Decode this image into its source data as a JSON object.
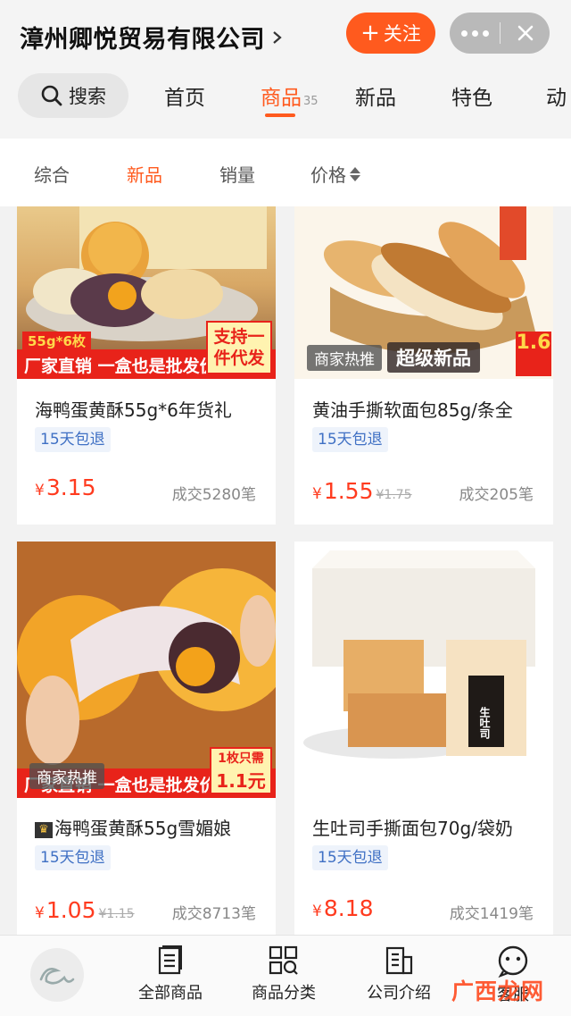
{
  "header": {
    "shop_name": "漳州卿悦贸易有限公司",
    "follow_label": "关注"
  },
  "nav": {
    "search_label": "搜索",
    "tabs": [
      {
        "label": "首页",
        "count": ""
      },
      {
        "label": "商品",
        "count": "35"
      },
      {
        "label": "新品",
        "count": ""
      },
      {
        "label": "特色",
        "count": ""
      },
      {
        "label": "动",
        "count": ""
      }
    ],
    "active_tab": "商品"
  },
  "filters": {
    "items": [
      "综合",
      "新品",
      "销量",
      "价格"
    ],
    "active": "新品"
  },
  "products": [
    {
      "title": "海鸭蛋黄酥55g*6年货礼",
      "badge": "15天包退",
      "currency": "¥",
      "price": "3.15",
      "old_price": "",
      "sold": "成交5280笔",
      "image_text": {
        "spec": "55g*6枚",
        "strip": "厂家直销 一盒也是批发价",
        "support": "支持一件代发"
      }
    },
    {
      "title": "黄油手撕软面包85g/条全",
      "badge": "15天包退",
      "currency": "¥",
      "price": "1.55",
      "old_price": "¥1.75",
      "sold": "成交205笔",
      "hot_tag": "商家热推",
      "new_tag": "超级新品",
      "image_text": {
        "price_tag": "1.6"
      }
    },
    {
      "title": "海鸭蛋黄酥55g雪媚娘",
      "badge": "15天包退",
      "currency": "¥",
      "price": "1.05",
      "old_price": "¥1.15",
      "sold": "成交8713笔",
      "hot_tag": "商家热推",
      "image_text": {
        "strip": "厂家直销 一盒也是批发价",
        "unit": "1枚只需",
        "unit_price": "1.1元"
      }
    },
    {
      "title": "生吐司手撕面包70g/袋奶",
      "badge": "15天包退",
      "currency": "¥",
      "price": "8.18",
      "old_price": "",
      "sold": "成交1419笔",
      "image_text": {
        "bag_label": "生吐司"
      }
    }
  ],
  "bottom_nav": {
    "items": [
      {
        "label": "全部商品",
        "icon": "list-icon"
      },
      {
        "label": "商品分类",
        "icon": "category-icon"
      },
      {
        "label": "公司介绍",
        "icon": "company-icon"
      },
      {
        "label": "客服",
        "icon": "chat-icon"
      }
    ]
  },
  "watermark": "广西龙网"
}
